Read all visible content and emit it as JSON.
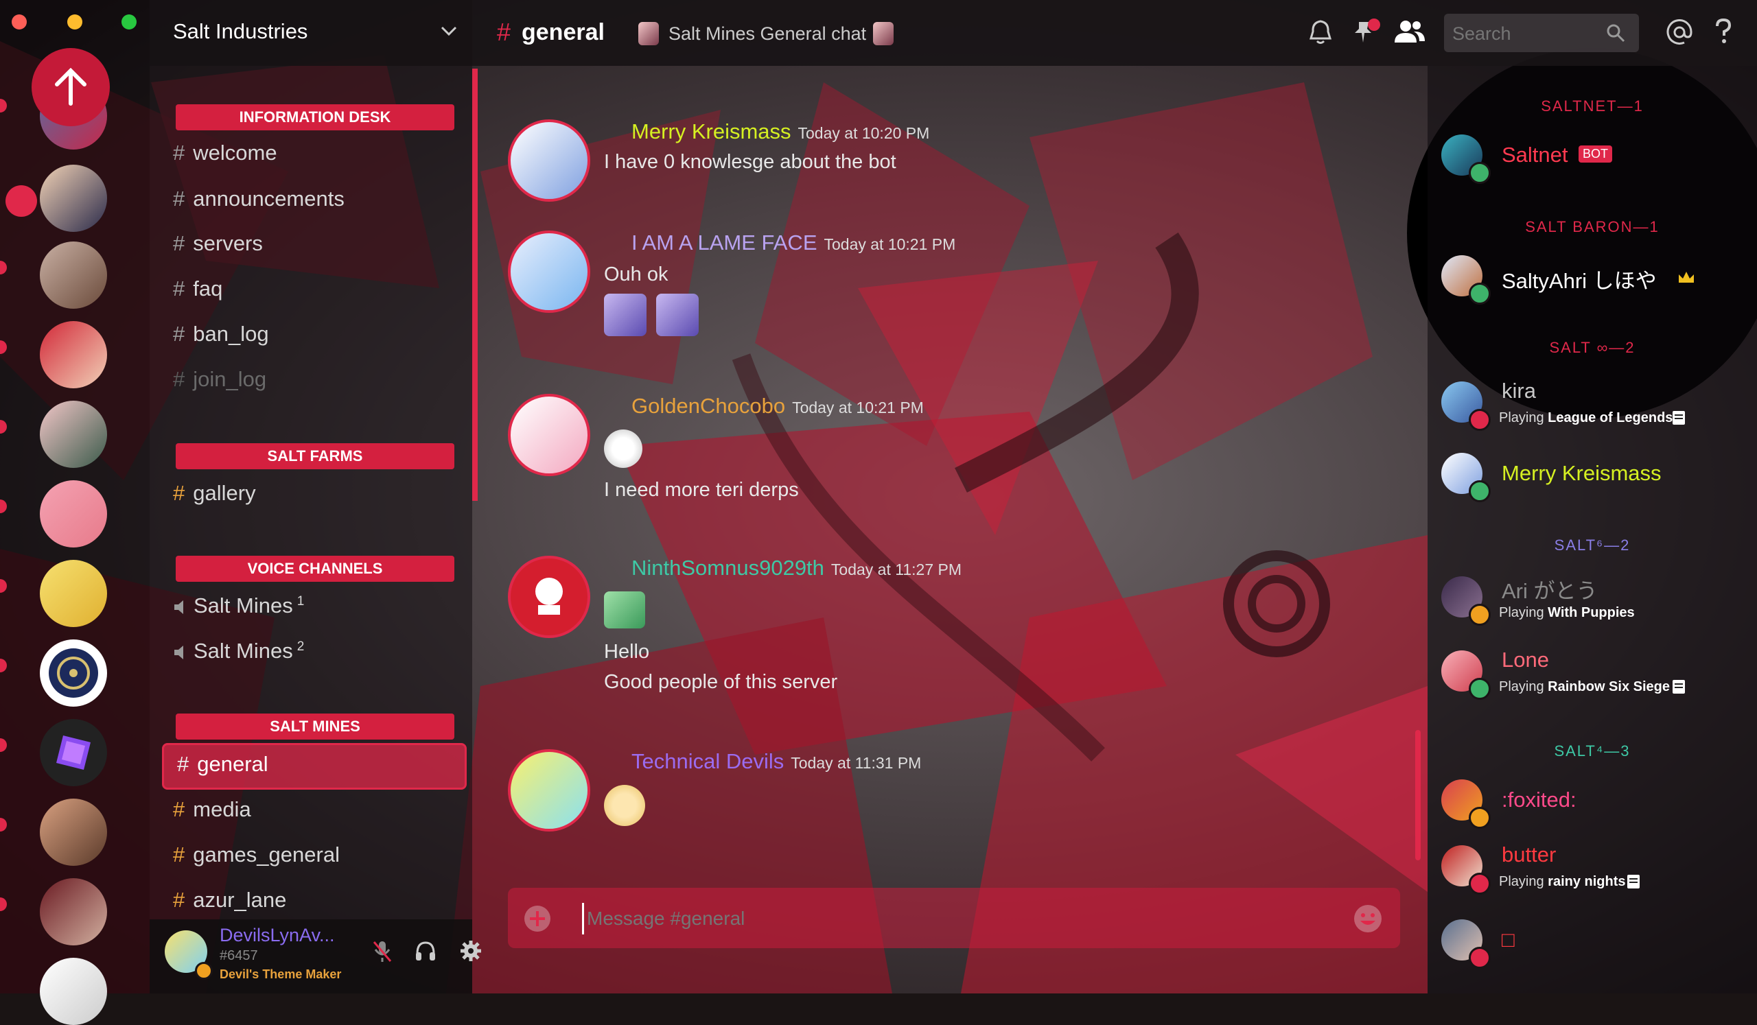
{
  "window": {
    "dot_colors": [
      "#fe5f57",
      "#febc2e",
      "#28c840"
    ]
  },
  "server": {
    "name": "Salt Industries"
  },
  "channel_header": {
    "hash": "#",
    "name": "general",
    "topic": "Salt Mines General chat"
  },
  "search": {
    "placeholder": "Search"
  },
  "categories": {
    "info": "INFORMATION DESK",
    "farms": "SALT FARMS",
    "voice": "VOICE CHANNELS",
    "mines": "SALT MINES"
  },
  "channels": {
    "welcome": "welcome",
    "announcements": "announcements",
    "servers": "servers",
    "faq": "faq",
    "ban_log": "ban_log",
    "join_log": "join_log",
    "gallery": "gallery",
    "salt_mines_1": "Salt Mines",
    "salt_mines_1_sup": "1",
    "salt_mines_2": "Salt Mines",
    "salt_mines_2_sup": "2",
    "general": "general",
    "media": "media",
    "games_general": "games_general",
    "azur_lane": "azur_lane",
    "hash": "#"
  },
  "user_panel": {
    "name": "DevilsLynAv...",
    "tag": "#6457",
    "status": "Devil's Theme Maker"
  },
  "messages": [
    {
      "author": "Merry Kreismass",
      "time": "Today at 10:20 PM",
      "color": "#d6f022",
      "lines": [
        "I have 0 knowlesge about the bot"
      ]
    },
    {
      "author": "I AM A LAME FACE",
      "time": "Today at 10:21 PM",
      "color": "#b9a3f0",
      "lines": [
        "Ouh ok"
      ]
    },
    {
      "author": "GoldenChocobo",
      "time": "Today at 10:21 PM",
      "color": "#e8a23c",
      "lines": [
        "I need more teri derps"
      ]
    },
    {
      "author": "NinthSomnus9029th",
      "time": "Today at 11:27 PM",
      "color": "#3ec9a6",
      "lines": [
        "Hello",
        "Good people of this server"
      ]
    },
    {
      "author": "Technical Devils",
      "time": "Today at 11:31 PM",
      "color": "#9b6cf0",
      "lines": []
    }
  ],
  "composer": {
    "placeholder": "Message #general"
  },
  "roles": [
    {
      "label": "SALTNET—1",
      "color": "#e0284a"
    },
    {
      "label": "SALT BARON—1",
      "color": "#e0284a"
    },
    {
      "label": "SALT ∞—2",
      "color": "#e0284a"
    },
    {
      "label": "SALT⁶—2",
      "color": "#8a7ee6"
    },
    {
      "label": "SALT⁴—3",
      "color": "#3ec9a6"
    }
  ],
  "members": [
    {
      "name": "Saltnet",
      "badge": "BOT",
      "color": "#ff3a50"
    },
    {
      "name": "SaltyAhri しほや",
      "color": "#ffffff"
    },
    {
      "name": "kira",
      "playing_prefix": "Playing",
      "game": "League of Legends",
      "color": "#c8c8c8"
    },
    {
      "name": "Merry Kreismass",
      "color": "#d6f022"
    },
    {
      "name": "Ari がとう",
      "playing_prefix": "Playing",
      "game": "With Puppies",
      "color": "#8a8a8a"
    },
    {
      "name": "Lone",
      "playing_prefix": "Playing",
      "game": "Rainbow Six Siege",
      "color": "#ff6a7a"
    },
    {
      "name": ":foxited:",
      "color": "#ff4a8a"
    },
    {
      "name": "butter",
      "playing_prefix": "Playing",
      "game": "rainy nights",
      "color": "#ff3a40"
    },
    {
      "name": "□",
      "color": "#ff3a40"
    }
  ]
}
